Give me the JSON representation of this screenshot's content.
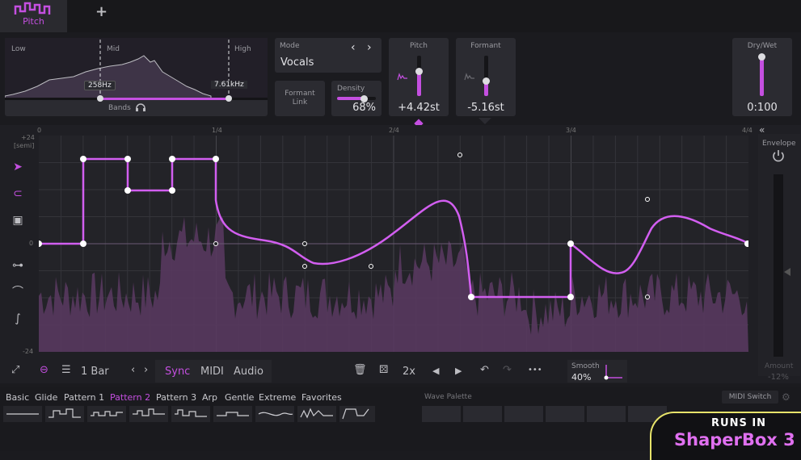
{
  "tab": {
    "label": "Pitch",
    "add": "+"
  },
  "bands": {
    "low": "Low",
    "mid": "Mid",
    "high": "High",
    "low_freq": "258Hz",
    "high_freq": "7.61kHz",
    "bands_label": "Bands"
  },
  "mode": {
    "label": "Mode",
    "value": "Vocals",
    "prev": "‹",
    "next": "›"
  },
  "formant_link": {
    "label": "Formant Link"
  },
  "density": {
    "label": "Density",
    "value": "68%",
    "level": 0.68
  },
  "pitch": {
    "label": "Pitch",
    "value": "+4.42st"
  },
  "formant": {
    "label": "Formant",
    "value": "-5.16st"
  },
  "drywet": {
    "label": "Dry/Wet",
    "value": "0:100"
  },
  "editor": {
    "timeline": [
      "0",
      "1/4",
      "2/4",
      "3/4",
      "4/4"
    ],
    "y_top": "+24",
    "unit": "[semi]",
    "y_zero": "0",
    "y_bottom": "-24",
    "collapse": "«",
    "envelope": "Envelope",
    "amount_label": "Amount",
    "amount_value": "-12%"
  },
  "toolbar": {
    "length": "1 Bar",
    "sync": "Sync",
    "midi": "MIDI",
    "audio": "Audio",
    "mult": "2x",
    "more": "•••",
    "smooth_label": "Smooth",
    "smooth_value": "40%"
  },
  "presets": {
    "categories": [
      "Basic",
      "Glide",
      "Pattern 1",
      "Pattern 2",
      "Pattern 3",
      "Arp",
      "Gentle",
      "Extreme",
      "Favorites"
    ],
    "active": "Pattern 2",
    "wave_palette": "Wave Palette",
    "midi_switch": "MIDI Switch"
  },
  "badge": {
    "line1": "RUNS IN",
    "line2": "ShaperBox 3"
  },
  "colors": {
    "accent": "#c44fe0",
    "bg": "#1b1b1f"
  }
}
